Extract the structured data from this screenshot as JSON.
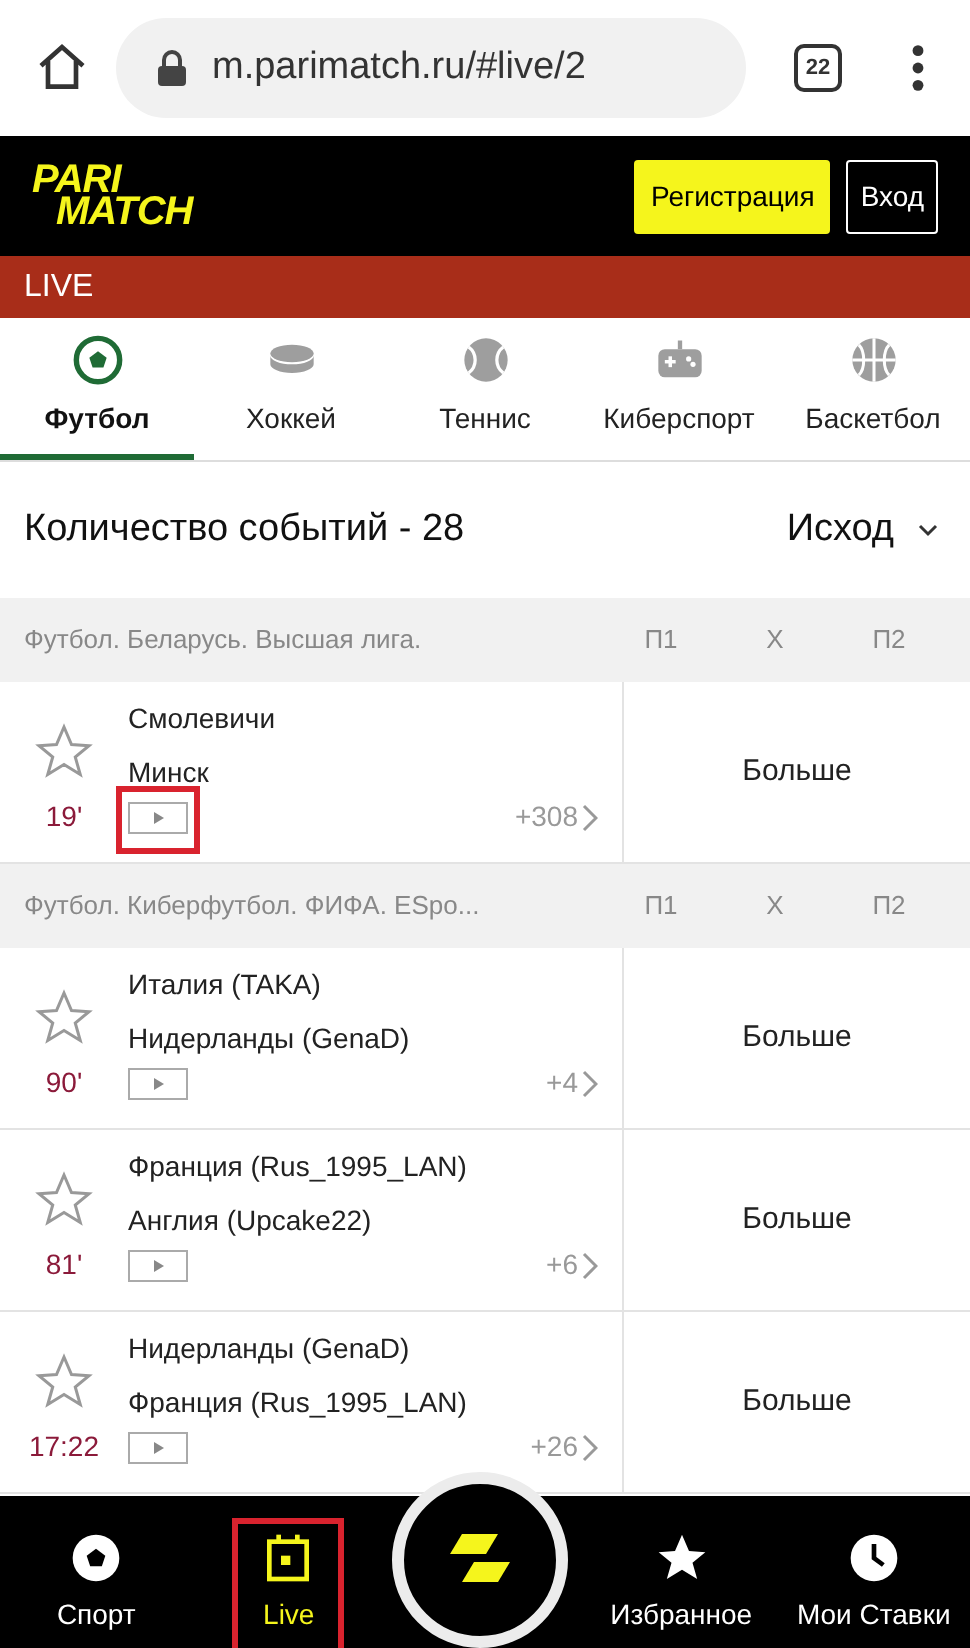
{
  "browser": {
    "url": "m.parimatch.ru/#live/2",
    "tab_count": "22"
  },
  "header": {
    "logo_lines": [
      "PARI",
      "MATCH"
    ],
    "register_button": "Регистрация",
    "login_button": "Вход"
  },
  "section_bar": {
    "title": "LIVE"
  },
  "sport_tabs": [
    {
      "label": "Футбол",
      "kind": "football",
      "selected": true
    },
    {
      "label": "Хоккей",
      "kind": "hockey",
      "selected": false
    },
    {
      "label": "Теннис",
      "kind": "tennis",
      "selected": false
    },
    {
      "label": "Киберспорт",
      "kind": "esports",
      "selected": false
    },
    {
      "label": "Баскетбол",
      "kind": "basketball",
      "selected": false
    }
  ],
  "events_bar": {
    "count_label": "Количество событий - 28",
    "market_select": "Исход"
  },
  "leagues": [
    {
      "title": "Футбол. Беларусь. Высшая лига.",
      "columns": [
        "П1",
        "X",
        "П2"
      ],
      "matches": [
        {
          "team_1": "Смолевичи",
          "team_2": "Минск",
          "time": "19'",
          "more": "+308",
          "odds": "Больше",
          "favorite": false,
          "highlighted": true
        }
      ]
    },
    {
      "title": "Футбол. Киберфутбол. ФИФА. ESpo...",
      "columns": [
        "П1",
        "X",
        "П2"
      ],
      "matches": [
        {
          "team_1": "Италия (TAKA)",
          "team_2": "Нидерланды (GenaD)",
          "time": "90'",
          "more": "+4",
          "odds": "Больше",
          "favorite": false,
          "highlighted": false
        },
        {
          "team_1": "Франция (Rus_1995_LAN)",
          "team_2": "Англия (Upcake22)",
          "time": "81'",
          "more": "+6",
          "odds": "Больше",
          "favorite": false,
          "highlighted": false
        },
        {
          "team_1": "Нидерланды (GenaD)",
          "team_2": "Франция (Rus_1995_LAN)",
          "time": "17:22",
          "more": "+26",
          "odds": "Больше",
          "favorite": false,
          "highlighted": false
        }
      ]
    }
  ],
  "bottom_nav": [
    {
      "label": "Спорт",
      "kind": "sport",
      "selected": false,
      "highlighted": false
    },
    {
      "label": "Live",
      "kind": "live",
      "selected": true,
      "highlighted": true
    },
    {
      "kind": "center"
    },
    {
      "label": "Избранное",
      "kind": "favorites",
      "selected": false,
      "highlighted": false
    },
    {
      "label": "Мои Ставки",
      "kind": "bets",
      "selected": false,
      "highlighted": false
    }
  ]
}
